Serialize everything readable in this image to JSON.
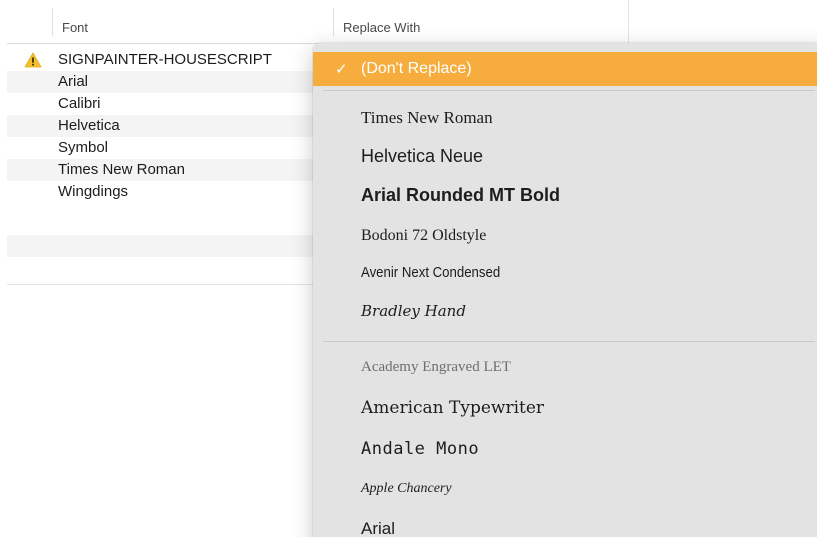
{
  "table": {
    "headers": {
      "font": "Font",
      "replace_with": "Replace With"
    },
    "rows": [
      {
        "name": "SIGNPAINTER-HOUSESCRIPT",
        "warning": true
      },
      {
        "name": "Arial",
        "warning": false
      },
      {
        "name": "Calibri",
        "warning": false
      },
      {
        "name": "Helvetica",
        "warning": false
      },
      {
        "name": "Symbol",
        "warning": false
      },
      {
        "name": "Times New Roman",
        "warning": false
      },
      {
        "name": "Wingdings",
        "warning": false
      },
      {
        "name": "",
        "warning": false
      },
      {
        "name": "",
        "warning": false
      }
    ],
    "warning_icon": "warning-triangle-icon",
    "warning_color": "#f5c02f"
  },
  "menu": {
    "selected": {
      "label": "(Don't Replace)",
      "check_icon": "checkmark-icon",
      "color": "#f6ad3e"
    },
    "recent_fonts": [
      "Times New Roman",
      "Helvetica Neue",
      "Arial Rounded MT Bold",
      "Bodoni 72 Oldstyle",
      "Avenir Next Condensed",
      "Bradley Hand"
    ],
    "all_fonts": [
      "Academy Engraved LET",
      "American Typewriter",
      "Andale Mono",
      "Apple Chancery",
      "Arial"
    ]
  }
}
